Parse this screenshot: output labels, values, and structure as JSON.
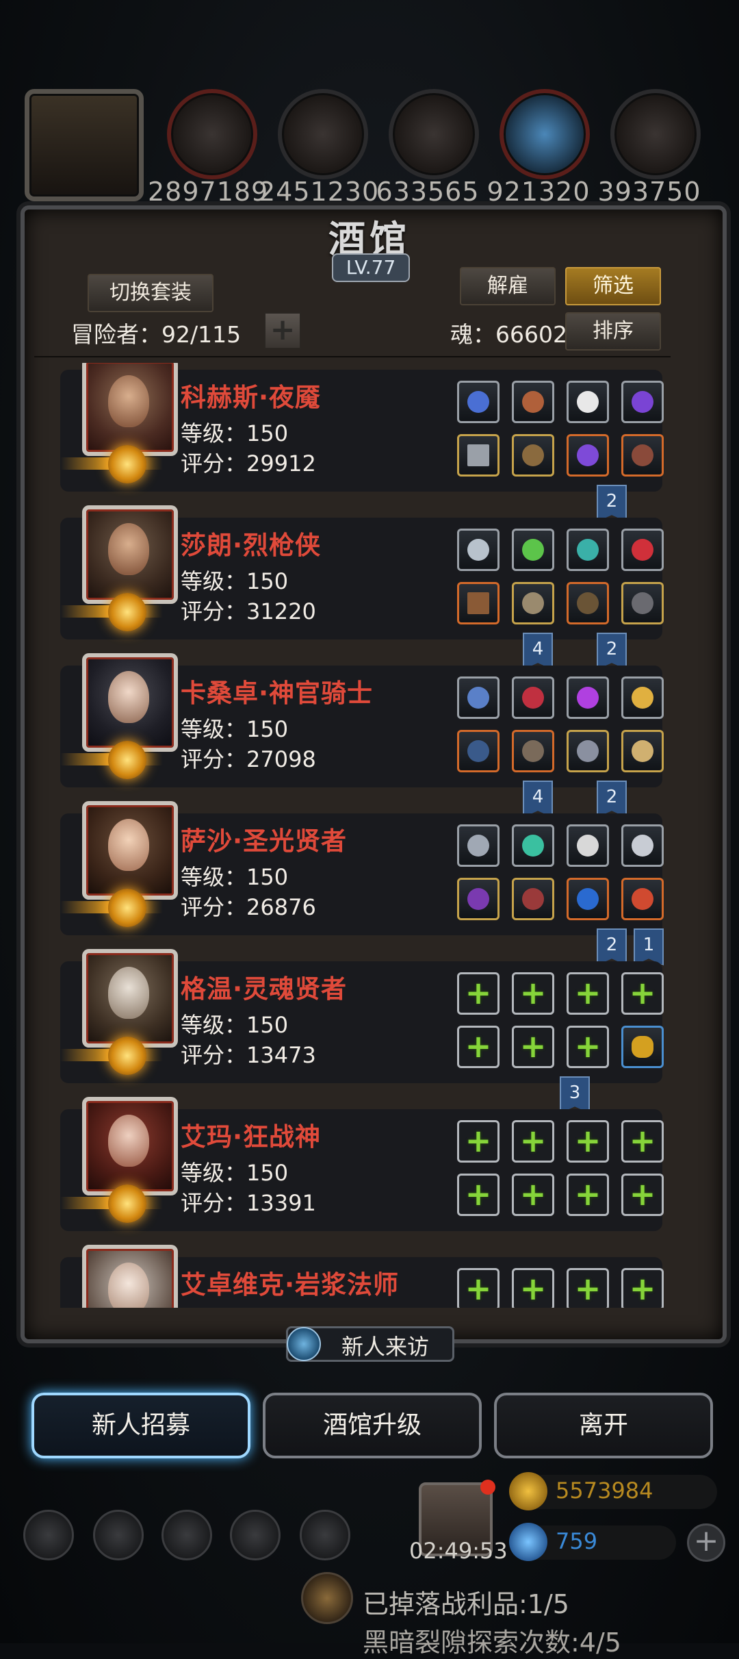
{
  "resources": {
    "values": [
      "2897189",
      "2451230",
      "633565",
      "921320",
      "393750"
    ]
  },
  "panel": {
    "title": "酒馆",
    "level": "LV.77",
    "switch_outfit": "切换套装",
    "dismiss": "解雇",
    "filter": "筛选",
    "sort": "排序",
    "adventurers": "冒险者：92/115",
    "soul": "魂：66602"
  },
  "heroes": [
    {
      "name": "科赫斯·夜魇",
      "level": "等级：150",
      "score": "评分：29912"
    },
    {
      "name": "莎朗·烈枪侠",
      "level": "等级：150",
      "score": "评分：31220"
    },
    {
      "name": "卡桑卓·神官骑士",
      "level": "等级：150",
      "score": "评分：27098"
    },
    {
      "name": "萨沙·圣光贤者",
      "level": "等级：150",
      "score": "评分：26876"
    },
    {
      "name": "格温·灵魂贤者",
      "level": "等级：150",
      "score": "评分：13473"
    },
    {
      "name": "艾玛·狂战神",
      "level": "等级：150",
      "score": "评分：13391"
    },
    {
      "name": "艾卓维克·岩浆法师"
    }
  ],
  "set_tags": {
    "t1": "2",
    "t2a": "4",
    "t2b": "2",
    "t3a": "4",
    "t3b": "2",
    "t4a": "2",
    "t4b": "1",
    "t5": "3"
  },
  "visitor": "新人来访",
  "buttons": {
    "recruit": "新人招募",
    "upgrade": "酒馆升级",
    "leave": "离开"
  },
  "hud": {
    "timer": "02:49:53",
    "gold": "5573984",
    "gems": "759",
    "loot": "已掉落战利品:1/5",
    "explore": "黑暗裂隙探索次数:4/5"
  },
  "colors": {
    "hero_name": "#e04a3a",
    "empty_plus": "#86d43a",
    "set_tag": "#2c4f7e",
    "active_button_glow": "#4fb8ff"
  }
}
